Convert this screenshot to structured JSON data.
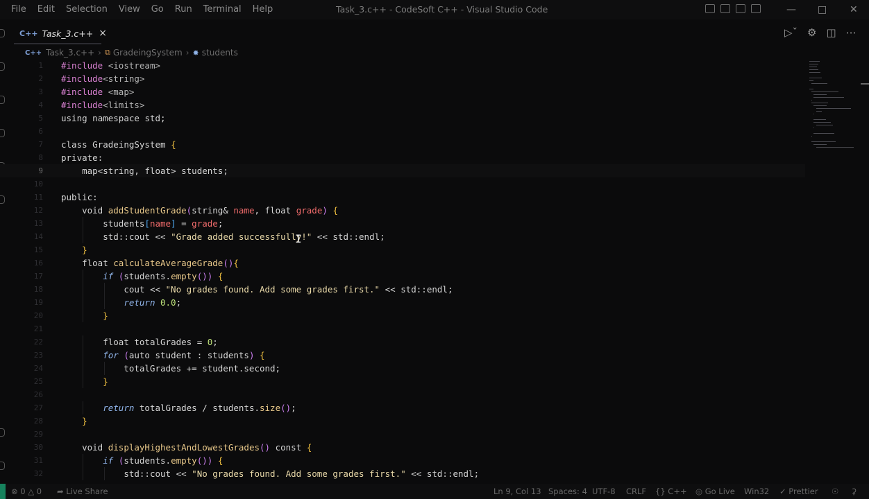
{
  "menu": [
    "File",
    "Edit",
    "Selection",
    "View",
    "Go",
    "Run",
    "Terminal",
    "Help"
  ],
  "window_title": "Task_3.c++ - CodeSoft C++ - Visual Studio Code",
  "tab": {
    "lang_icon": "C++",
    "label": "Task_3.c++",
    "close": "×"
  },
  "breadcrumb": {
    "file": "Task_3.c++",
    "class": "GradeingSystem",
    "member": "students"
  },
  "current_line": 9,
  "status": {
    "errors": "0",
    "warnings": "0",
    "live_share": "Live Share",
    "position": "Ln 9, Col 13",
    "spaces": "Spaces: 4",
    "encoding": "UTF-8",
    "eol": "CRLF",
    "language": "C++",
    "go_live": "Go Live",
    "platform": "Win32",
    "prettier": "Prettier"
  },
  "code_lines": [
    {
      "n": "1",
      "t": "#include <iostream>"
    },
    {
      "n": "2",
      "t": "#include<string>"
    },
    {
      "n": "3",
      "t": "#include <map>"
    },
    {
      "n": "4",
      "t": "#include<limits>"
    },
    {
      "n": "5",
      "t": "using namespace std;"
    },
    {
      "n": "6",
      "t": ""
    },
    {
      "n": "7",
      "t": "class GradeingSystem {"
    },
    {
      "n": "8",
      "t": "private:"
    },
    {
      "n": "9",
      "t": "    map<string, float> students;"
    },
    {
      "n": "10",
      "t": ""
    },
    {
      "n": "11",
      "t": "public:"
    },
    {
      "n": "12",
      "t": "    void addStudentGrade(string& name, float grade) {"
    },
    {
      "n": "13",
      "t": "        students[name] = grade;"
    },
    {
      "n": "14",
      "t": "        std::cout << \"Grade added successfully!\" << std::endl;"
    },
    {
      "n": "15",
      "t": "    }"
    },
    {
      "n": "16",
      "t": "    float calculateAverageGrade(){"
    },
    {
      "n": "17",
      "t": "        if (students.empty()) {"
    },
    {
      "n": "18",
      "t": "            cout << \"No grades found. Add some grades first.\" << std::endl;"
    },
    {
      "n": "19",
      "t": "            return 0.0;"
    },
    {
      "n": "20",
      "t": "        }"
    },
    {
      "n": "21",
      "t": ""
    },
    {
      "n": "22",
      "t": "        float totalGrades = 0;"
    },
    {
      "n": "23",
      "t": "        for (auto student : students) {"
    },
    {
      "n": "24",
      "t": "            totalGrades += student.second;"
    },
    {
      "n": "25",
      "t": "        }"
    },
    {
      "n": "26",
      "t": ""
    },
    {
      "n": "27",
      "t": "        return totalGrades / students.size();"
    },
    {
      "n": "28",
      "t": "    }"
    },
    {
      "n": "29",
      "t": ""
    },
    {
      "n": "30",
      "t": "    void displayHighestAndLowestGrades() const {"
    },
    {
      "n": "31",
      "t": "        if (students.empty()) {"
    },
    {
      "n": "32",
      "t": "            std::cout << \"No grades found. Add some grades first.\" << std::endl;"
    }
  ]
}
